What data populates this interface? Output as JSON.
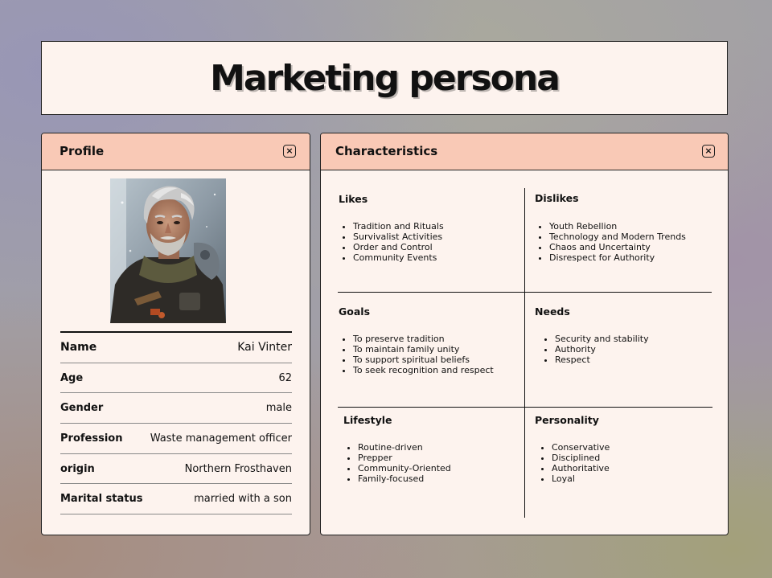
{
  "title": "Marketing persona",
  "profile": {
    "header": "Profile",
    "close_icon": "×",
    "portrait": "portrait-image",
    "rows": [
      {
        "label": "Name",
        "value": "Kai Vinter"
      },
      {
        "label": "Age",
        "value": "62"
      },
      {
        "label": "Gender",
        "value": "male"
      },
      {
        "label": "Profession",
        "value": "Waste management officer"
      },
      {
        "label": "origin",
        "value": "Northern Frosthaven"
      },
      {
        "label": "Marital status",
        "value": "married with a son"
      }
    ]
  },
  "characteristics": {
    "header": "Characteristics",
    "close_icon": "×",
    "likes": {
      "title": "Likes",
      "items": [
        "Tradition and Rituals",
        "Survivalist Activities",
        "Order and Control",
        "Community Events"
      ]
    },
    "dislikes": {
      "title": "Dislikes",
      "items": [
        "Youth Rebellion",
        "Technology and Modern Trends",
        "Chaos and Uncertainty",
        "Disrespect for Authority"
      ]
    },
    "goals": {
      "title": "Goals",
      "items": [
        "To preserve tradition",
        "To maintain family unity",
        "To support spiritual beliefs",
        "To seek recognition and respect"
      ]
    },
    "needs": {
      "title": "Needs",
      "items": [
        "Security and stability",
        "Authority",
        "Respect"
      ]
    },
    "lifestyle": {
      "title": "Lifestyle",
      "items": [
        "Routine-driven",
        "Prepper",
        "Community-Oriented",
        "Family-focused"
      ]
    },
    "personality": {
      "title": "Personality",
      "items": [
        "Conservative",
        "Disciplined",
        "Authoritative",
        "Loyal"
      ]
    }
  },
  "colors": {
    "panel_bg": "#fdf3ee",
    "header_bg": "#f9c9b6",
    "border": "#222222"
  }
}
